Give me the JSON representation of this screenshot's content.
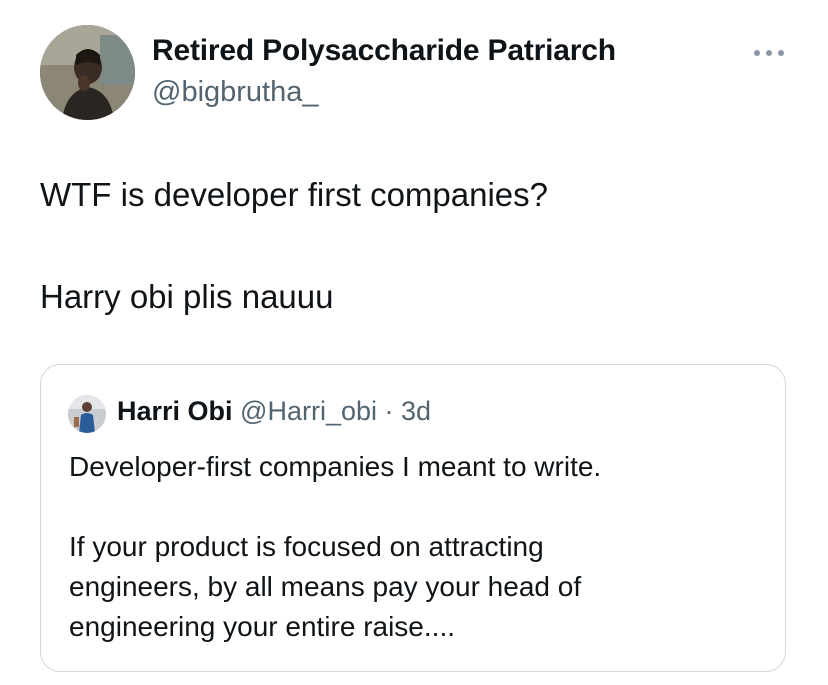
{
  "tweet": {
    "author_name": "Retired Polysaccharide Patriarch",
    "author_handle": "@bigbrutha_",
    "text_line1": "WTF is developer first companies?",
    "text_line2": "Harry obi plis nauuu"
  },
  "icons": {
    "more": "more-horizontal-icon",
    "avatar": "profile-photo"
  },
  "quote": {
    "author_name": "Harri Obi",
    "author_handle": "@Harri_obi",
    "separator": "·",
    "age": "3d",
    "line1": "Developer-first companies I meant to write.",
    "line2": "If your product is focused on attracting",
    "line3": "engineers, by all means pay your head of",
    "line4": "engineering your entire raise...."
  },
  "colors": {
    "text_primary": "#0f1419",
    "text_secondary": "#536471",
    "border": "#cfd9de"
  }
}
